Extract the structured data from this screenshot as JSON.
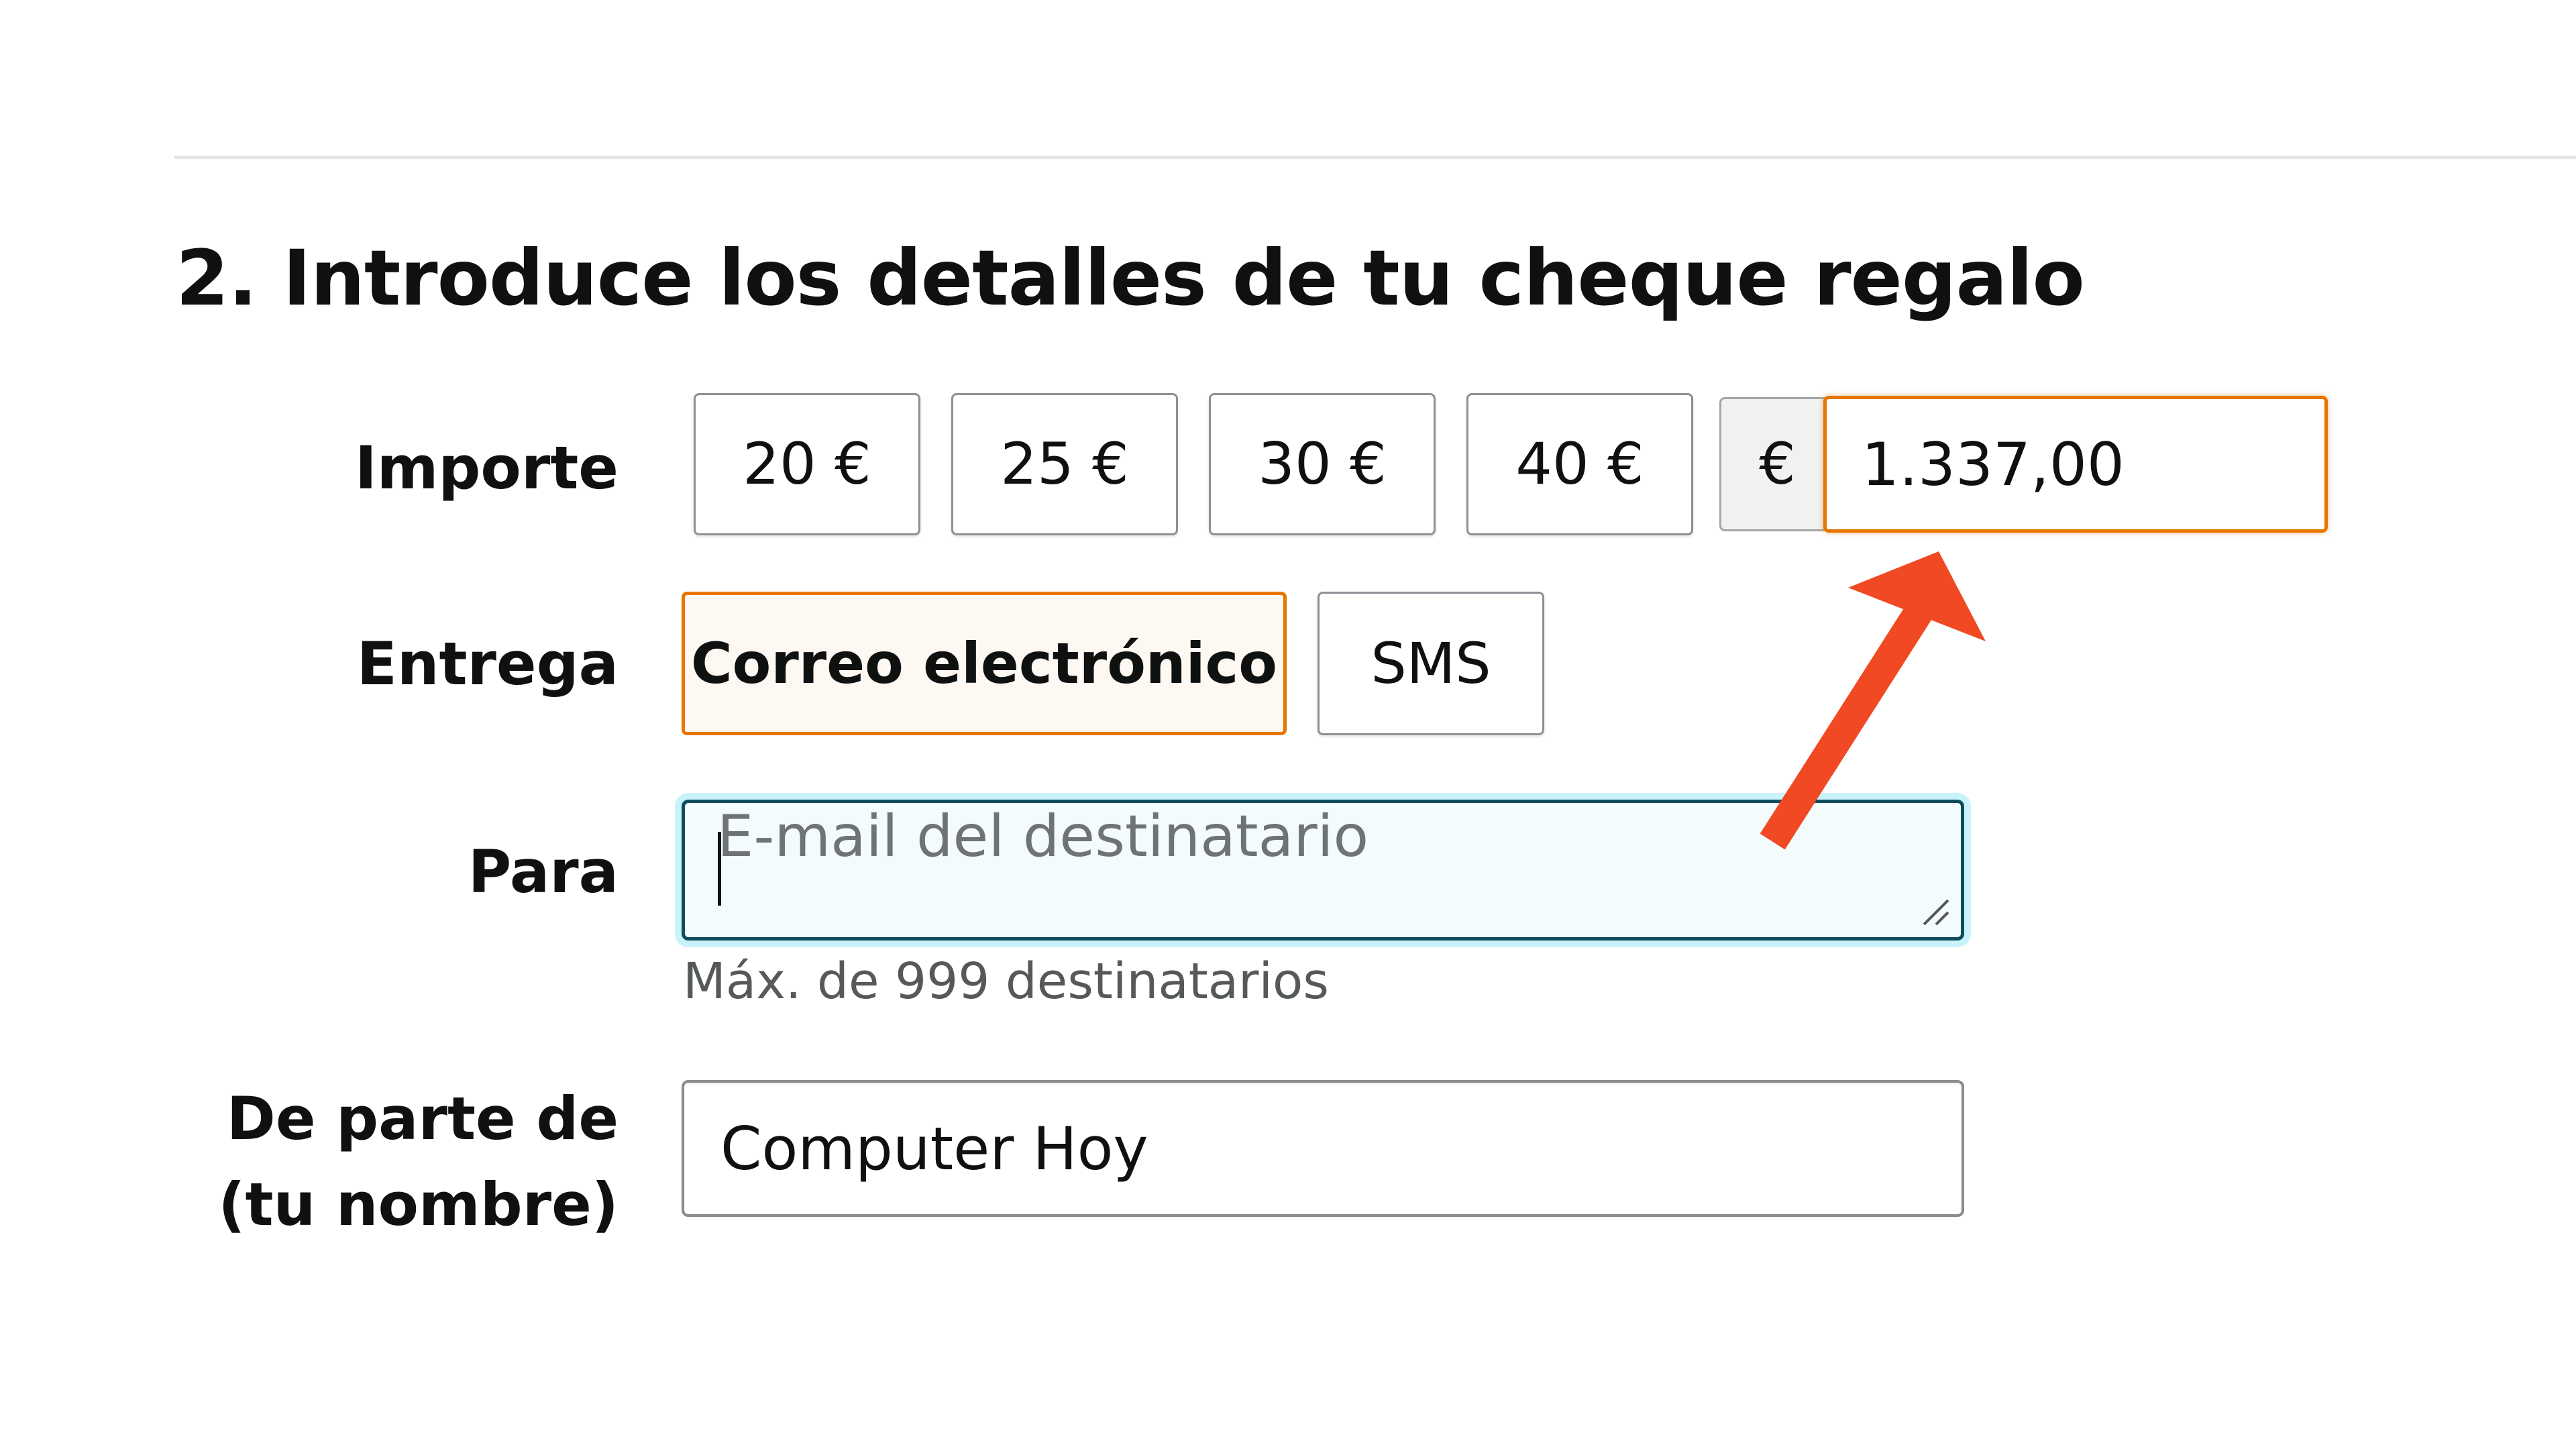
{
  "section": {
    "heading": "2. Introduce los detalles de tu cheque regalo"
  },
  "amount": {
    "label": "Importe",
    "options": [
      "20 €",
      "25 €",
      "30 €",
      "40 €"
    ],
    "currency_symbol": "€",
    "custom_value": "1.337,00"
  },
  "delivery": {
    "label": "Entrega",
    "options": [
      "Correo electrónico",
      "SMS"
    ],
    "selected": "Correo electrónico"
  },
  "recipient": {
    "label": "Para",
    "placeholder": "E-mail del destinatario",
    "hint": "Máx. de 999 destinatarios"
  },
  "sender": {
    "label_line1": "De parte de",
    "label_line2": "(tu nombre)",
    "value": "Computer Hoy"
  },
  "annotation": {
    "icon": "red-arrow-icon",
    "color": "#f04923"
  },
  "colors": {
    "selected_border": "#e77600",
    "focus_border": "#0f4d5e",
    "focus_ring": "#c8f3fa"
  }
}
